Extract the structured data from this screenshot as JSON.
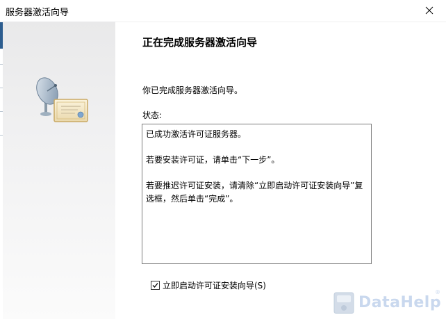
{
  "window": {
    "title": "服务器激活向导",
    "close_icon": "close-icon"
  },
  "side_panel": {
    "art_icon": "satellite-dish-certificate-icon"
  },
  "main": {
    "heading": "正在完成服务器激活向导",
    "intro": "你已完成服务器激活向导。",
    "status_label": "状态:",
    "status_lines": [
      "已成功激活许可证服务器。",
      "若要安装许可证，请单击“下一步”。",
      "若要推迟许可证安装，请清除“立即启动许可证安装向导”复选框，然后单击“完成”。"
    ],
    "checkbox": {
      "label": "立即启动许可证安装向导(S)",
      "checked": true
    }
  },
  "watermark": {
    "text": "DataHelp",
    "registered_mark": "®",
    "color": "#c9d8ee"
  }
}
